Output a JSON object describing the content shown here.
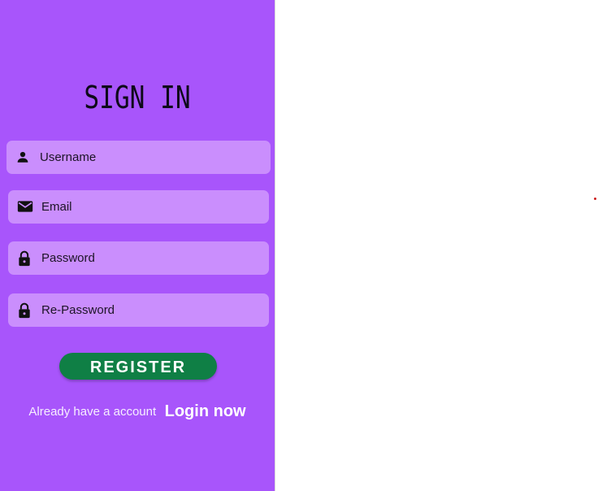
{
  "form": {
    "title": "SIGN IN",
    "fields": [
      {
        "placeholder": "Username",
        "icon": "person-icon"
      },
      {
        "placeholder": "Email",
        "icon": "mail-icon"
      },
      {
        "placeholder": "Password",
        "icon": "lock-icon"
      },
      {
        "placeholder": "Re-Password",
        "icon": "lock-icon"
      }
    ],
    "register_label": "REGISTER",
    "footer_prompt": "Already have a account",
    "login_link": "Login now"
  },
  "colors": {
    "panel": "#a855fb",
    "field": "#ca8efd",
    "button": "#0f7f45",
    "background": "#ffffff",
    "dot": "#cc1d1d"
  }
}
